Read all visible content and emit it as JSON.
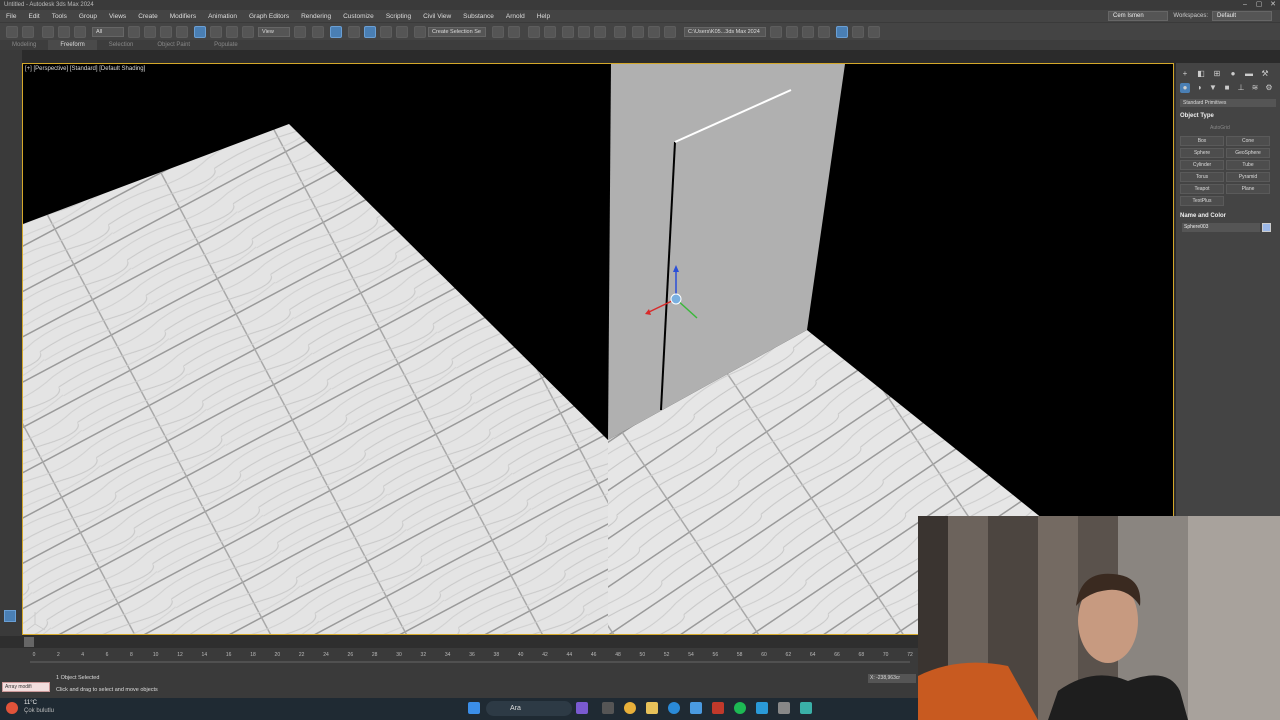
{
  "window": {
    "title": "Untitled - Autodesk 3ds Max 2024"
  },
  "menu": [
    "File",
    "Edit",
    "Tools",
    "Group",
    "Views",
    "Create",
    "Modifiers",
    "Animation",
    "Graph Editors",
    "Rendering",
    "Customize",
    "Scripting",
    "Civil View",
    "Substance",
    "Arnold",
    "Help"
  ],
  "user": {
    "name": "Cem Ismen",
    "workspace_label": "Workspaces:",
    "workspace_value": "Default"
  },
  "toolbar": {
    "filter": "All",
    "ref_coord": "View",
    "named_sel": "Create Selection Se",
    "project_path": "C:\\Users\\K05...3ds Max 2024"
  },
  "ribbon": {
    "tabs": [
      "Modeling",
      "Freeform",
      "Selection",
      "Object Paint",
      "Populate"
    ],
    "active": "Freeform"
  },
  "viewport": {
    "label": "[+] [Perspective] [Standard] [Default Shading]"
  },
  "command_panel": {
    "dropdown": "Standard Primitives",
    "object_type_title": "Object Type",
    "autogrid": "AutoGrid",
    "buttons": [
      "Box",
      "Cone",
      "Sphere",
      "GeoSphere",
      "Cylinder",
      "Tube",
      "Torus",
      "Pyramid",
      "Teapot",
      "Plane",
      "TextPlus"
    ],
    "name_color_title": "Name and Color",
    "object_name": "Sphere003",
    "object_color": "#9cb8e8"
  },
  "timeline": {
    "ticks": [
      "0",
      "2",
      "4",
      "6",
      "8",
      "10",
      "12",
      "14",
      "16",
      "18",
      "20",
      "22",
      "24",
      "26",
      "28",
      "30",
      "32",
      "34",
      "36",
      "38",
      "40",
      "42",
      "44",
      "46",
      "48",
      "50",
      "52",
      "54",
      "56",
      "58",
      "60",
      "62",
      "64",
      "66",
      "68",
      "70",
      "72"
    ]
  },
  "status": {
    "maxscript": "Array modifi",
    "selected": "1 Object Selected",
    "prompt": "Click and drag to select and move objects",
    "coord_x": "X: -238,963cr"
  },
  "taskbar": {
    "temp": "11°C",
    "weather": "Çok bulutlu",
    "search": "Ara"
  }
}
